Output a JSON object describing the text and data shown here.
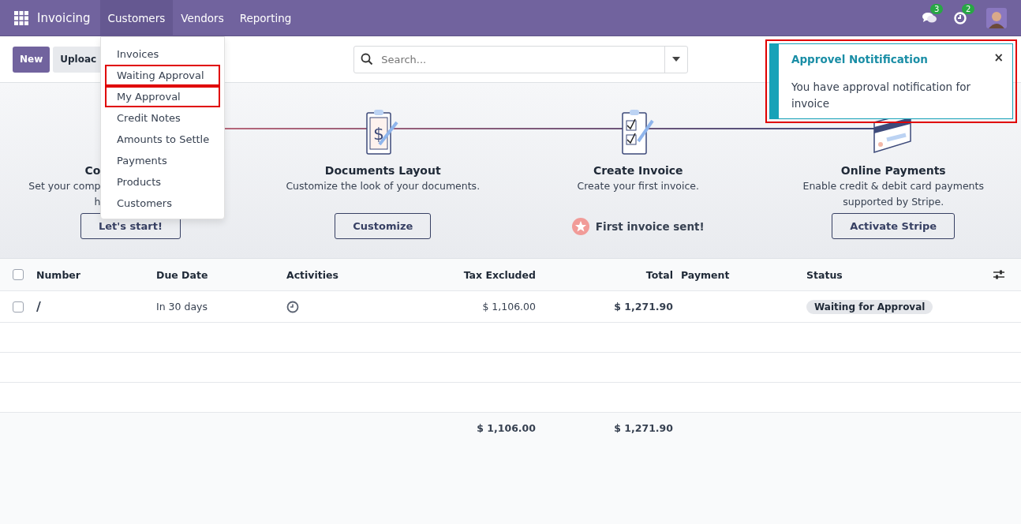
{
  "navbar": {
    "app_name": "Invoicing",
    "menus": [
      {
        "label": "Customers",
        "selected": true
      },
      {
        "label": "Vendors",
        "selected": false
      },
      {
        "label": "Reporting",
        "selected": false
      }
    ],
    "messages_count": "3",
    "activities_count": "2"
  },
  "control_panel": {
    "buttons": [
      {
        "label": "New",
        "kind": "primary"
      },
      {
        "label": "Uploac",
        "kind": "secondary"
      }
    ],
    "search": {
      "placeholder": "Search..."
    }
  },
  "dropdown": {
    "items": [
      {
        "label": "Invoices",
        "highlighted": false
      },
      {
        "label": "Waiting Approval",
        "highlighted": true
      },
      {
        "label": "My Approval",
        "highlighted": true
      },
      {
        "label": "Credit Notes",
        "highlighted": false
      },
      {
        "label": "Amounts to Settle",
        "highlighted": false
      },
      {
        "label": "Payments",
        "highlighted": false
      },
      {
        "label": "Products",
        "highlighted": false
      },
      {
        "label": "Customers",
        "highlighted": false
      }
    ]
  },
  "notification": {
    "title": "Approvel Notitification",
    "message": "You have approval notification for invoice",
    "close": "×",
    "highlighted": true
  },
  "onboarding": {
    "steps": [
      {
        "kind": "partial",
        "title": "Co",
        "description": [
          "Set your comp",
          "h"
        ],
        "action": {
          "kind": "button",
          "label": "Let's start!"
        }
      },
      {
        "kind": "layout",
        "symbol": "$",
        "title": "Documents Layout",
        "description": [
          "Customize the look of your documents."
        ],
        "action": {
          "kind": "button",
          "label": "Customize"
        }
      },
      {
        "kind": "invoice",
        "title": "Create Invoice",
        "description": [
          "Create your first invoice."
        ],
        "action": {
          "kind": "done",
          "label": "First invoice sent!"
        }
      },
      {
        "kind": "payment",
        "title": "Online Payments",
        "description": [
          "Enable credit & debit card payments",
          "supported by Stripe."
        ],
        "action": {
          "kind": "button",
          "label": "Activate Stripe"
        }
      }
    ]
  },
  "table": {
    "columns": [
      "Number",
      "Due Date",
      "Activities",
      "Tax Excluded",
      "Total",
      "Payment",
      "Status"
    ],
    "select_all": {
      "checked": false
    },
    "rows": [
      {
        "checked": false,
        "number": "/",
        "due_date": "In 30 days",
        "tax_excluded": "$ 1,106.00",
        "total": "$ 1,271.90",
        "status": "Waiting for Approval"
      }
    ],
    "totals": {
      "tax_excluded": "$ 1,106.00",
      "total": "$ 1,271.90"
    }
  }
}
